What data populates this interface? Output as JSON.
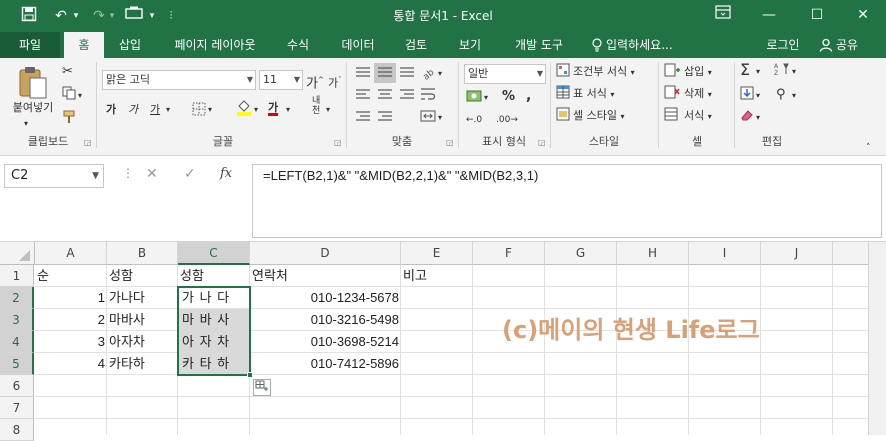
{
  "titlebar": {
    "title": "통합 문서1  -  Excel",
    "save_icon": "save-icon",
    "undo_icon": "undo-icon",
    "redo_icon": "redo-icon",
    "restore_ribbon_icon": "ribbon-display-icon",
    "minimize_glyph": "—",
    "maximize_glyph": "☐",
    "close_glyph": "✕"
  },
  "tabs": {
    "file": "파일",
    "home": "홈",
    "insert": "삽입",
    "page_layout": "페이지 레이아웃",
    "formulas": "수식",
    "data": "데이터",
    "review": "검토",
    "view": "보기",
    "developer": "개발 도구",
    "tell_me": "입력하세요...",
    "signin": "로그인",
    "share": "공유"
  },
  "ribbon": {
    "paste_label": "붙여넣기",
    "font_name": "맑은 고딕",
    "font_size": "11",
    "bold": "가",
    "italic": "가",
    "underline": "가",
    "font_color_letter": "가",
    "number_format": "일반",
    "conditional_format": "조건부 서식",
    "format_as_table": "표 서식",
    "cell_styles": "셀 스타일",
    "insert_cells": "삽입",
    "delete_cells": "삭제",
    "format_cells": "서식",
    "groups": {
      "clipboard": "클립보드",
      "font": "글꼴",
      "alignment": "맞춤",
      "number": "표시 형식",
      "styles": "스타일",
      "cells": "셀",
      "editing": "편집"
    },
    "colors": {
      "accent": "#217346",
      "ribbon_bg": "#f3f3f3"
    }
  },
  "formula_bar": {
    "name_box": "C2",
    "fx": "fx",
    "formula": "=LEFT(B2,1)&\" \"&MID(B2,2,1)&\" \"&MID(B2,3,1)"
  },
  "sheet": {
    "columns": [
      "A",
      "B",
      "C",
      "D",
      "E",
      "F",
      "G",
      "H",
      "I",
      "J"
    ],
    "rows": [
      "1",
      "2",
      "3",
      "4",
      "5",
      "6",
      "7",
      "8"
    ],
    "headers": {
      "a": "순",
      "b": "성함",
      "c": "성함",
      "d": "연락처",
      "e": "비고"
    },
    "data": [
      {
        "a": "1",
        "b": "가나다",
        "c": "가 나 다",
        "d": "010-1234-5678"
      },
      {
        "a": "2",
        "b": "마바사",
        "c": "마 바 사",
        "d": "010-3216-5498"
      },
      {
        "a": "3",
        "b": "아자차",
        "c": "아 자 차",
        "d": "010-3698-5214"
      },
      {
        "a": "4",
        "b": "카타하",
        "c": "카 타 하",
        "d": "010-7412-5896"
      }
    ],
    "watermark": "(c)메이의 현생 Life로그",
    "watermark_color": "#d9a074"
  }
}
